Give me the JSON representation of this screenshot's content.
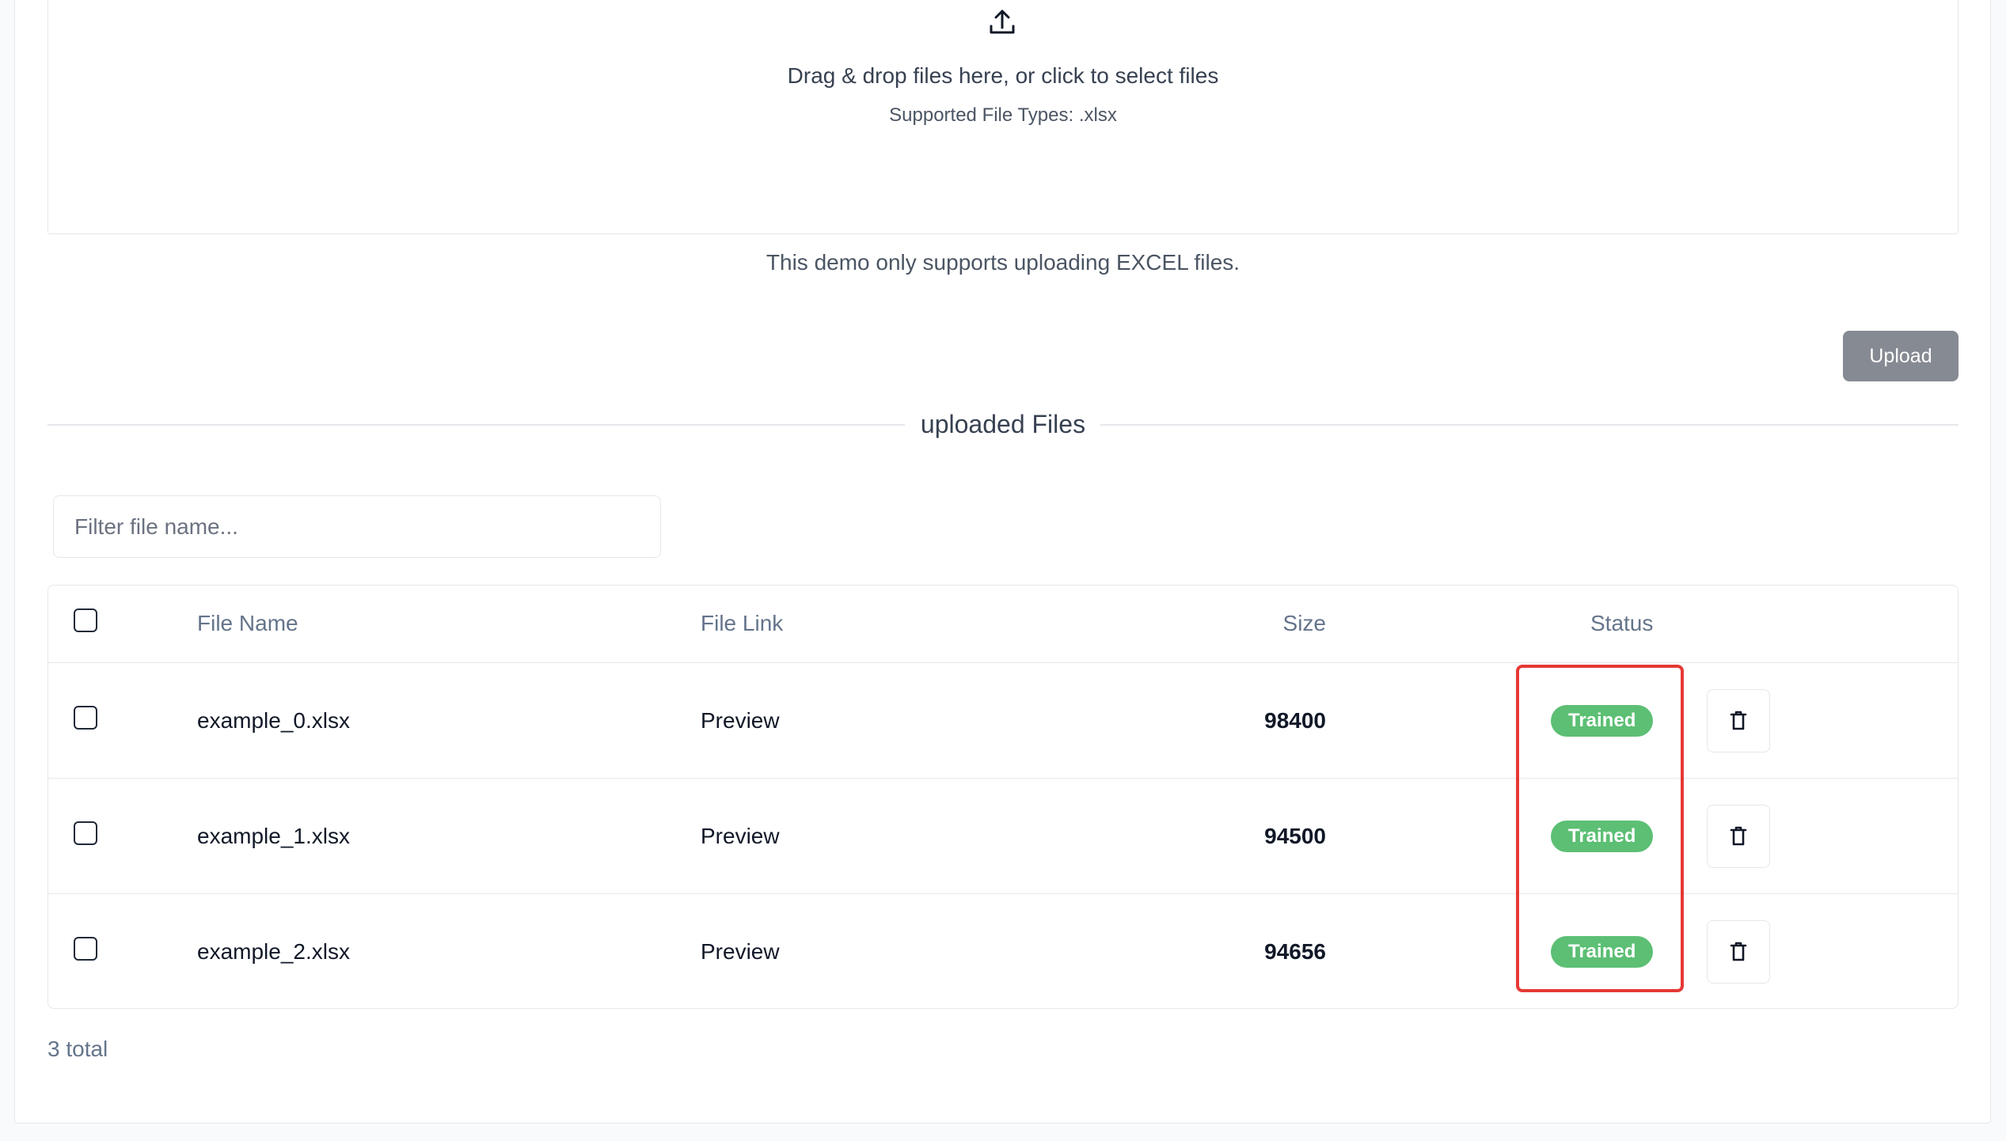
{
  "dropzone": {
    "icon": "upload-icon",
    "instruction": "Drag & drop files here, or click to select files",
    "supported_types": "Supported File Types: .xlsx"
  },
  "demo_note": "This demo only supports uploading EXCEL files.",
  "upload_button": "Upload",
  "section_title": "uploaded Files",
  "filter": {
    "placeholder": "Filter file name...",
    "value": ""
  },
  "table": {
    "headers": {
      "file_name": "File Name",
      "file_link": "File Link",
      "size": "Size",
      "status": "Status"
    },
    "rows": [
      {
        "file_name": "example_0.xlsx",
        "file_link": "Preview",
        "size": "98400",
        "status": "Trained",
        "delete_icon": "trash-icon"
      },
      {
        "file_name": "example_1.xlsx",
        "file_link": "Preview",
        "size": "94500",
        "status": "Trained",
        "delete_icon": "trash-icon"
      },
      {
        "file_name": "example_2.xlsx",
        "file_link": "Preview",
        "size": "94656",
        "status": "Trained",
        "delete_icon": "trash-icon"
      }
    ]
  },
  "total": "3 total",
  "colors": {
    "status_trained": "#5cbf74",
    "upload_button_bg": "#868a93",
    "highlight_border": "#e53935"
  }
}
